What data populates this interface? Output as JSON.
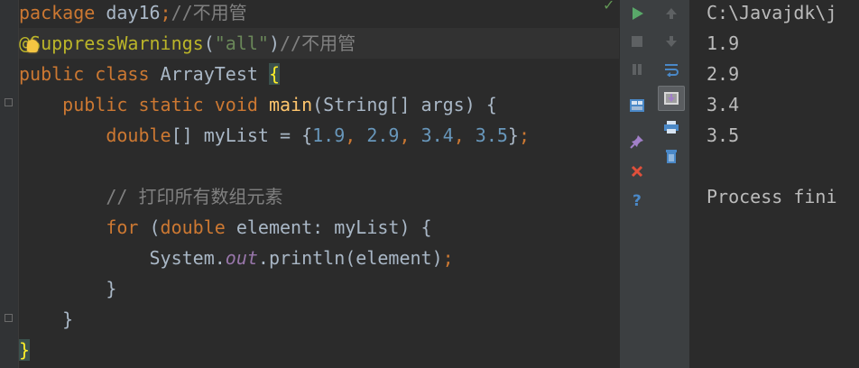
{
  "editor": {
    "lines": [
      {
        "segments": [
          {
            "t": "package ",
            "c": "kw"
          },
          {
            "t": "day16",
            "c": ""
          },
          {
            "t": ";",
            "c": "kw"
          },
          {
            "t": "//不用管",
            "c": "cmt"
          }
        ]
      },
      {
        "segments": [
          {
            "t": "@SuppressWarnings",
            "c": "ann"
          },
          {
            "t": "(",
            "c": ""
          },
          {
            "t": "\"all\"",
            "c": "str"
          },
          {
            "t": ")",
            "c": ""
          },
          {
            "t": "//不用管",
            "c": "cmt"
          }
        ]
      },
      {
        "segments": [
          {
            "t": "public class ",
            "c": "kw"
          },
          {
            "t": "ArrayTest ",
            "c": ""
          },
          {
            "t": "{",
            "c": "brace-hl"
          }
        ]
      },
      {
        "segments": [
          {
            "t": "    public static void ",
            "c": "kw"
          },
          {
            "t": "main",
            "c": "fn"
          },
          {
            "t": "(String[] args) {",
            "c": ""
          }
        ]
      },
      {
        "segments": [
          {
            "t": "        double",
            "c": "kw"
          },
          {
            "t": "[] myList = {",
            "c": ""
          },
          {
            "t": "1.9",
            "c": "num"
          },
          {
            "t": ", ",
            "c": "kw"
          },
          {
            "t": "2.9",
            "c": "num"
          },
          {
            "t": ", ",
            "c": "kw"
          },
          {
            "t": "3.4",
            "c": "num"
          },
          {
            "t": ", ",
            "c": "kw"
          },
          {
            "t": "3.5",
            "c": "num"
          },
          {
            "t": "}",
            "c": ""
          },
          {
            "t": ";",
            "c": "kw"
          }
        ]
      },
      {
        "segments": []
      },
      {
        "segments": [
          {
            "t": "        // 打印所有数组元素",
            "c": "cmt"
          }
        ]
      },
      {
        "segments": [
          {
            "t": "        for ",
            "c": "kw"
          },
          {
            "t": "(",
            "c": ""
          },
          {
            "t": "double ",
            "c": "kw"
          },
          {
            "t": "element: myList) {",
            "c": ""
          }
        ]
      },
      {
        "segments": [
          {
            "t": "            System.",
            "c": ""
          },
          {
            "t": "out",
            "c": "stat"
          },
          {
            "t": ".println(element)",
            "c": ""
          },
          {
            "t": ";",
            "c": "kw"
          }
        ]
      },
      {
        "segments": [
          {
            "t": "        }",
            "c": ""
          }
        ]
      },
      {
        "segments": [
          {
            "t": "    }",
            "c": ""
          }
        ]
      },
      {
        "segments": [
          {
            "t": "}",
            "c": "brace-hl"
          }
        ]
      }
    ],
    "current_line": 1
  },
  "toolbar_left": [
    {
      "name": "run-icon",
      "label": "Rerun"
    },
    {
      "name": "stop-icon",
      "label": "Stop"
    },
    {
      "name": "pause-icon",
      "label": "Pause"
    },
    {
      "name": "dump-threads-icon",
      "label": "Dump Threads"
    },
    {
      "name": "pin-icon",
      "label": "Pin Tab"
    },
    {
      "name": "close-icon",
      "label": "Close"
    },
    {
      "name": "help-icon",
      "label": "Help"
    }
  ],
  "toolbar_right": [
    {
      "name": "up-arrow-icon",
      "label": "Up the Stack Trace"
    },
    {
      "name": "down-arrow-icon",
      "label": "Down the Stack Trace"
    },
    {
      "name": "soft-wrap-icon",
      "label": "Soft-Wrap"
    },
    {
      "name": "scroll-to-end-icon",
      "label": "Scroll to the end"
    },
    {
      "name": "print-icon",
      "label": "Print"
    },
    {
      "name": "trash-icon",
      "label": "Clear All"
    }
  ],
  "console": {
    "lines": [
      "C:\\Javajdk\\j",
      "1.9",
      "2.9",
      "3.4",
      "3.5",
      "",
      "Process fini"
    ]
  }
}
